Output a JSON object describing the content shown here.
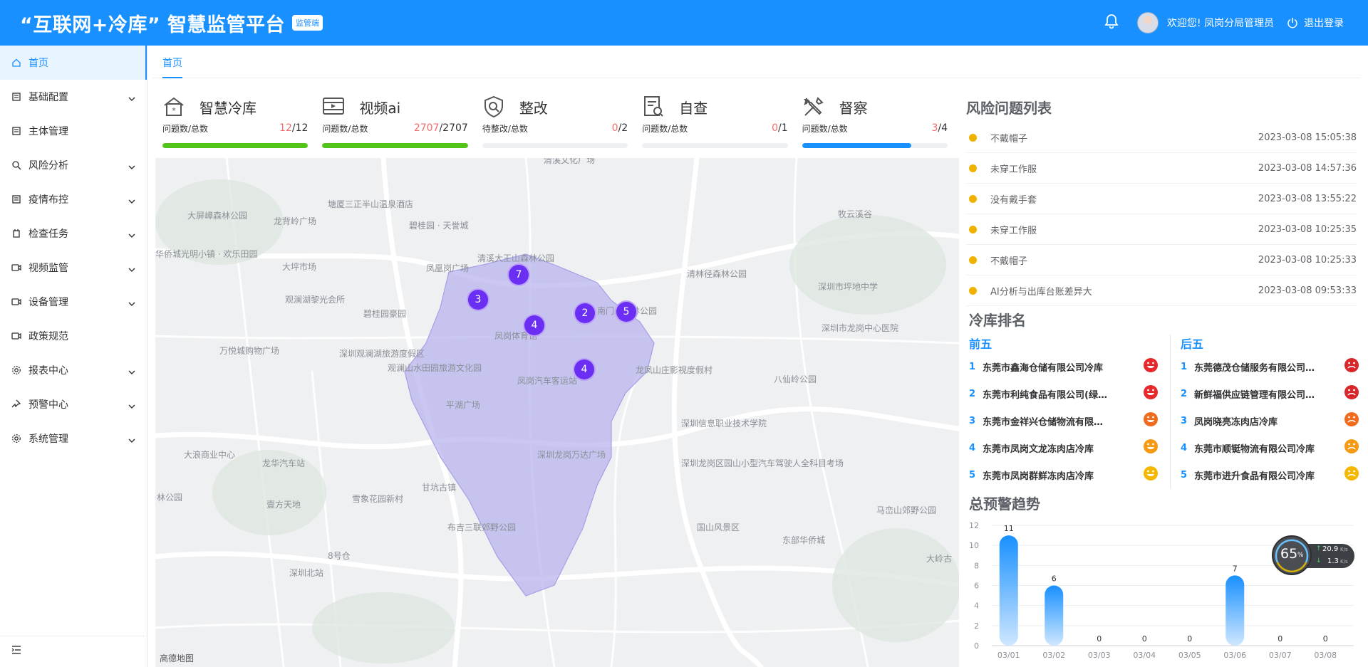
{
  "header": {
    "title": "“互联网+冷库” 智慧监管平台",
    "badge": "监管端",
    "welcome": "欢迎您! 凤岗分局管理员",
    "logout": "退出登录"
  },
  "sidebar": {
    "items": [
      {
        "label": "首页",
        "icon": "home-icon",
        "active": true
      },
      {
        "label": "基础配置",
        "icon": "config-icon",
        "expandable": true
      },
      {
        "label": "主体管理",
        "icon": "entity-icon"
      },
      {
        "label": "风险分析",
        "icon": "search-icon",
        "expandable": true
      },
      {
        "label": "疫情布控",
        "icon": "doc-icon",
        "expandable": true
      },
      {
        "label": "检查任务",
        "icon": "task-icon",
        "expandable": true
      },
      {
        "label": "视频监管",
        "icon": "video-icon",
        "expandable": true
      },
      {
        "label": "设备管理",
        "icon": "device-icon",
        "expandable": true
      },
      {
        "label": "政策规范",
        "icon": "policy-icon"
      },
      {
        "label": "报表中心",
        "icon": "gear-icon",
        "expandable": true
      },
      {
        "label": "预警中心",
        "icon": "pin-icon",
        "expandable": true
      },
      {
        "label": "系统管理",
        "icon": "gear-icon",
        "expandable": true
      }
    ]
  },
  "tabs": [
    {
      "label": "首页"
    }
  ],
  "stats": [
    {
      "title": "智慧冷库",
      "icon": "snowflake-house-icon",
      "sub": "问题数/总数",
      "problem": "12",
      "total": "/12",
      "progress": 1.0,
      "color": "#52c41a"
    },
    {
      "title": "视频ai",
      "icon": "film-icon",
      "sub": "问题数/总数",
      "problem": "2707",
      "total": "/2707",
      "progress": 1.0,
      "color": "#52c41a"
    },
    {
      "title": "整改",
      "icon": "shield-search-icon",
      "sub": "待整改/总数",
      "problem": "0",
      "total": "/2",
      "progress": 0,
      "color": "#52c41a"
    },
    {
      "title": "自查",
      "icon": "document-search-icon",
      "sub": "问题数/总数",
      "problem": "0",
      "total": "/1",
      "progress": 0,
      "color": "#52c41a"
    },
    {
      "title": "督察",
      "icon": "tools-icon",
      "sub": "问题数/总数",
      "problem": "3",
      "total": "/4",
      "progress": 0.75,
      "color": "#1890ff"
    }
  ],
  "map": {
    "labels": [
      "清溪文化广场",
      "塘厦三正半山温泉酒店",
      "大屏嶂森林公园",
      "龙背岭广场",
      "碧桂园 · 天誉城",
      "凤凰岗广场",
      "清溪大王山森林公园",
      "华侨城光明小镇 · 欢乐田园",
      "大坪市场",
      "观澜湖黎光会所",
      "碧桂园豪园",
      "南门山森林公园",
      "清林径森林公园",
      "牧云溪谷",
      "深圳市坪地中学",
      "深圳市龙岗中心医院",
      "万悦城购物广场",
      "深圳观澜湖旅游度假区",
      "凤岗体育馆",
      "观澜山水田园旅游文化园",
      "凤岗汽车客运站",
      "龙凤山庄影视度假村",
      "八仙岭公园",
      "平湖广场",
      "深圳信息职业技术学院",
      "深圳龙岗万达广场",
      "大浪商业中心",
      "龙华汽车站",
      "深圳龙岗区园山小型汽车驾驶人全科目考场",
      "林公园",
      "甘坑古镇",
      "壹方天地",
      "雪象花园新村",
      "布吉三联郊野公园",
      "国山风景区",
      "东部华侨城",
      "马峦山郊野公园",
      "大岭古",
      "8号仓",
      "深圳北站"
    ],
    "clusters": [
      "7",
      "3",
      "4",
      "2",
      "5",
      "4"
    ],
    "logo": "高德地图"
  },
  "risk": {
    "title": "风险问题列表",
    "items": [
      {
        "name": "不戴帽子",
        "time": "2023-03-08 15:05:38"
      },
      {
        "name": "未穿工作服",
        "time": "2023-03-08 14:57:36"
      },
      {
        "name": "没有戴手套",
        "time": "2023-03-08 13:55:22"
      },
      {
        "name": "未穿工作服",
        "time": "2023-03-08 10:25:35"
      },
      {
        "name": "不戴帽子",
        "time": "2023-03-08 10:25:33"
      },
      {
        "name": "AI分析与出库台账差异大",
        "time": "2023-03-08 09:53:33"
      }
    ]
  },
  "ranking": {
    "title": "冷库排名",
    "top_label": "前五",
    "bottom_label": "后五",
    "top": [
      {
        "idx": "1",
        "name": "东莞市鑫海仓储有限公司冷库",
        "face": "#e8282a"
      },
      {
        "idx": "2",
        "name": "东莞市利纯食品有限公司(绿…",
        "face": "#e8282a"
      },
      {
        "idx": "3",
        "name": "东莞市金祥兴仓储物流有限…",
        "face": "#f26b1d"
      },
      {
        "idx": "4",
        "name": "东莞市凤岗文龙冻肉店冷库",
        "face": "#f59a12"
      },
      {
        "idx": "5",
        "name": "东莞市凤岗群鲜冻肉店冷库",
        "face": "#f5b800"
      }
    ],
    "bottom": [
      {
        "idx": "1",
        "name": "东莞德茂仓储服务有限公司…",
        "face": "#d9262a"
      },
      {
        "idx": "2",
        "name": "新鲜福供应链管理有限公司…",
        "face": "#d9262a"
      },
      {
        "idx": "3",
        "name": "凤岗晓亮冻肉店冷库",
        "face": "#f26b1d"
      },
      {
        "idx": "4",
        "name": "东莞市顺铤物流有限公司冷库",
        "face": "#f59a12"
      },
      {
        "idx": "5",
        "name": "东莞市进升食品有限公司冷库",
        "face": "#f5b800"
      }
    ]
  },
  "trend": {
    "title": "总预警趋势"
  },
  "chart_data": {
    "type": "bar",
    "title": "总预警趋势",
    "categories": [
      "03/01",
      "03/02",
      "03/03",
      "03/04",
      "03/05",
      "03/06",
      "03/07",
      "03/08"
    ],
    "values": [
      11,
      6,
      0,
      0,
      0,
      7,
      0,
      0
    ],
    "yticks": [
      0,
      2,
      4,
      6,
      8,
      10,
      12
    ],
    "ylim": [
      0,
      12
    ],
    "grid": true,
    "color": "#1890ff"
  },
  "speed_widget": {
    "percent": "65",
    "unit": "%",
    "up": "20.9",
    "down": "1.3",
    "rate_unit": "K/s"
  }
}
